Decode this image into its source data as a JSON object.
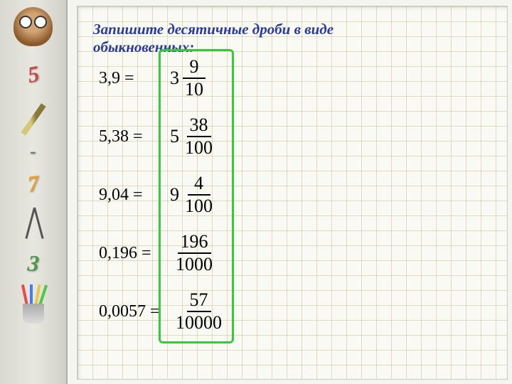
{
  "title_line1": "Запишите десятичные дроби в виде",
  "title_line2": "обыкновенных:",
  "sidebar": {
    "numbers": [
      "5",
      "-",
      "7",
      "3"
    ]
  },
  "problems": [
    {
      "decimal": "3,9 =",
      "whole": "3",
      "num": "9",
      "den": "10"
    },
    {
      "decimal": "5,38 =",
      "whole": "5",
      "num": "38",
      "den": "100"
    },
    {
      "decimal": "9,04 =",
      "whole": "9",
      "num": "4",
      "den": "100"
    },
    {
      "decimal": "0,196 =",
      "whole": "",
      "num": "196",
      "den": "1000"
    },
    {
      "decimal": "0,0057 =",
      "whole": "",
      "num": "57",
      "den": "10000"
    }
  ]
}
